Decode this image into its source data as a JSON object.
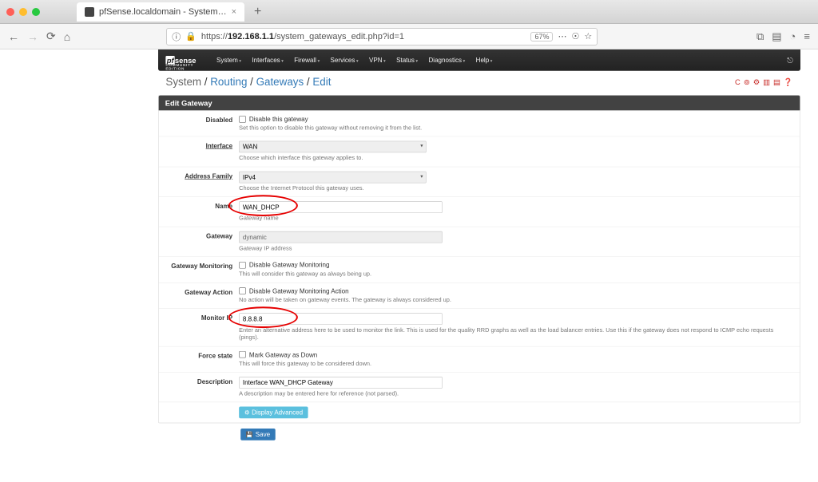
{
  "browser": {
    "tab_title": "pfSense.localdomain - System…",
    "url_prefix": "https://",
    "url_host": "192.168.1.1",
    "url_path": "/system_gateways_edit.php?id=1",
    "zoom": "67%"
  },
  "logo": {
    "pf": "pf",
    "sense": "sense",
    "edition": "COMMUNITY EDITION"
  },
  "nav": [
    "System",
    "Interfaces",
    "Firewall",
    "Services",
    "VPN",
    "Status",
    "Diagnostics",
    "Help"
  ],
  "breadcrumb": {
    "a": "System",
    "b": "Routing",
    "c": "Gateways",
    "d": "Edit"
  },
  "panel_title": "Edit Gateway",
  "fields": {
    "disabled": {
      "label": "Disabled",
      "chk": "Disable this gateway",
      "hint": "Set this option to disable this gateway without removing it from the list."
    },
    "interface": {
      "label": "Interface",
      "value": "WAN",
      "hint": "Choose which interface this gateway applies to."
    },
    "addrfam": {
      "label": "Address Family",
      "value": "IPv4",
      "hint": "Choose the Internet Protocol this gateway uses."
    },
    "name": {
      "label": "Name",
      "value": "WAN_DHCP",
      "hint": "Gateway name"
    },
    "gateway": {
      "label": "Gateway",
      "value": "dynamic",
      "hint": "Gateway IP address"
    },
    "gwmon": {
      "label": "Gateway Monitoring",
      "chk": "Disable Gateway Monitoring",
      "hint": "This will consider this gateway as always being up."
    },
    "gwact": {
      "label": "Gateway Action",
      "chk": "Disable Gateway Monitoring Action",
      "hint": "No action will be taken on gateway events. The gateway is always considered up."
    },
    "monip": {
      "label": "Monitor IP",
      "value": "8.8.8.8",
      "hint": "Enter an alternative address here to be used to monitor the link. This is used for the quality RRD graphs as well as the load balancer entries. Use this if the gateway does not respond to ICMP echo requests (pings)."
    },
    "force": {
      "label": "Force state",
      "chk": "Mark Gateway as Down",
      "hint": "This will force this gateway to be considered down."
    },
    "desc": {
      "label": "Description",
      "value": "Interface WAN_DHCP Gateway",
      "hint": "A description may be entered here for reference (not parsed)."
    }
  },
  "buttons": {
    "advanced": "Display Advanced",
    "save": "Save"
  }
}
